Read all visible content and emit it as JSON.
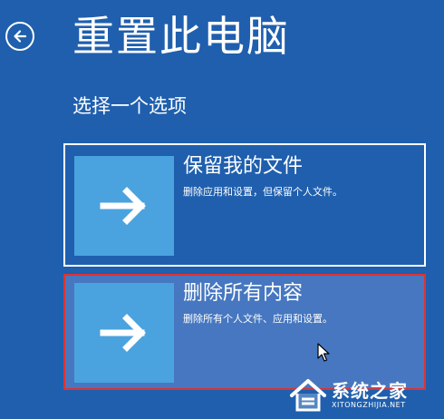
{
  "header": {
    "title": "重置此电脑",
    "subtitle": "选择一个选项",
    "back_icon": "back-arrow-circle-icon"
  },
  "options": [
    {
      "title": "保留我的文件",
      "description": "删除应用和设置，但保留个人文件。",
      "icon": "arrow-right-icon",
      "selected": false
    },
    {
      "title": "删除所有内容",
      "description": "删除所有个人文件、应用和设置。",
      "icon": "arrow-right-icon",
      "selected": true
    }
  ],
  "watermark": {
    "name": "系统之家",
    "domain": "XITONGZHIJIA.NET"
  },
  "colors": {
    "background": "#1f5fae",
    "tile": "#4aa3df",
    "selected_background": "#4677c0",
    "selected_border": "#e0322f",
    "option_border": "#ffffff",
    "text": "#ffffff"
  }
}
